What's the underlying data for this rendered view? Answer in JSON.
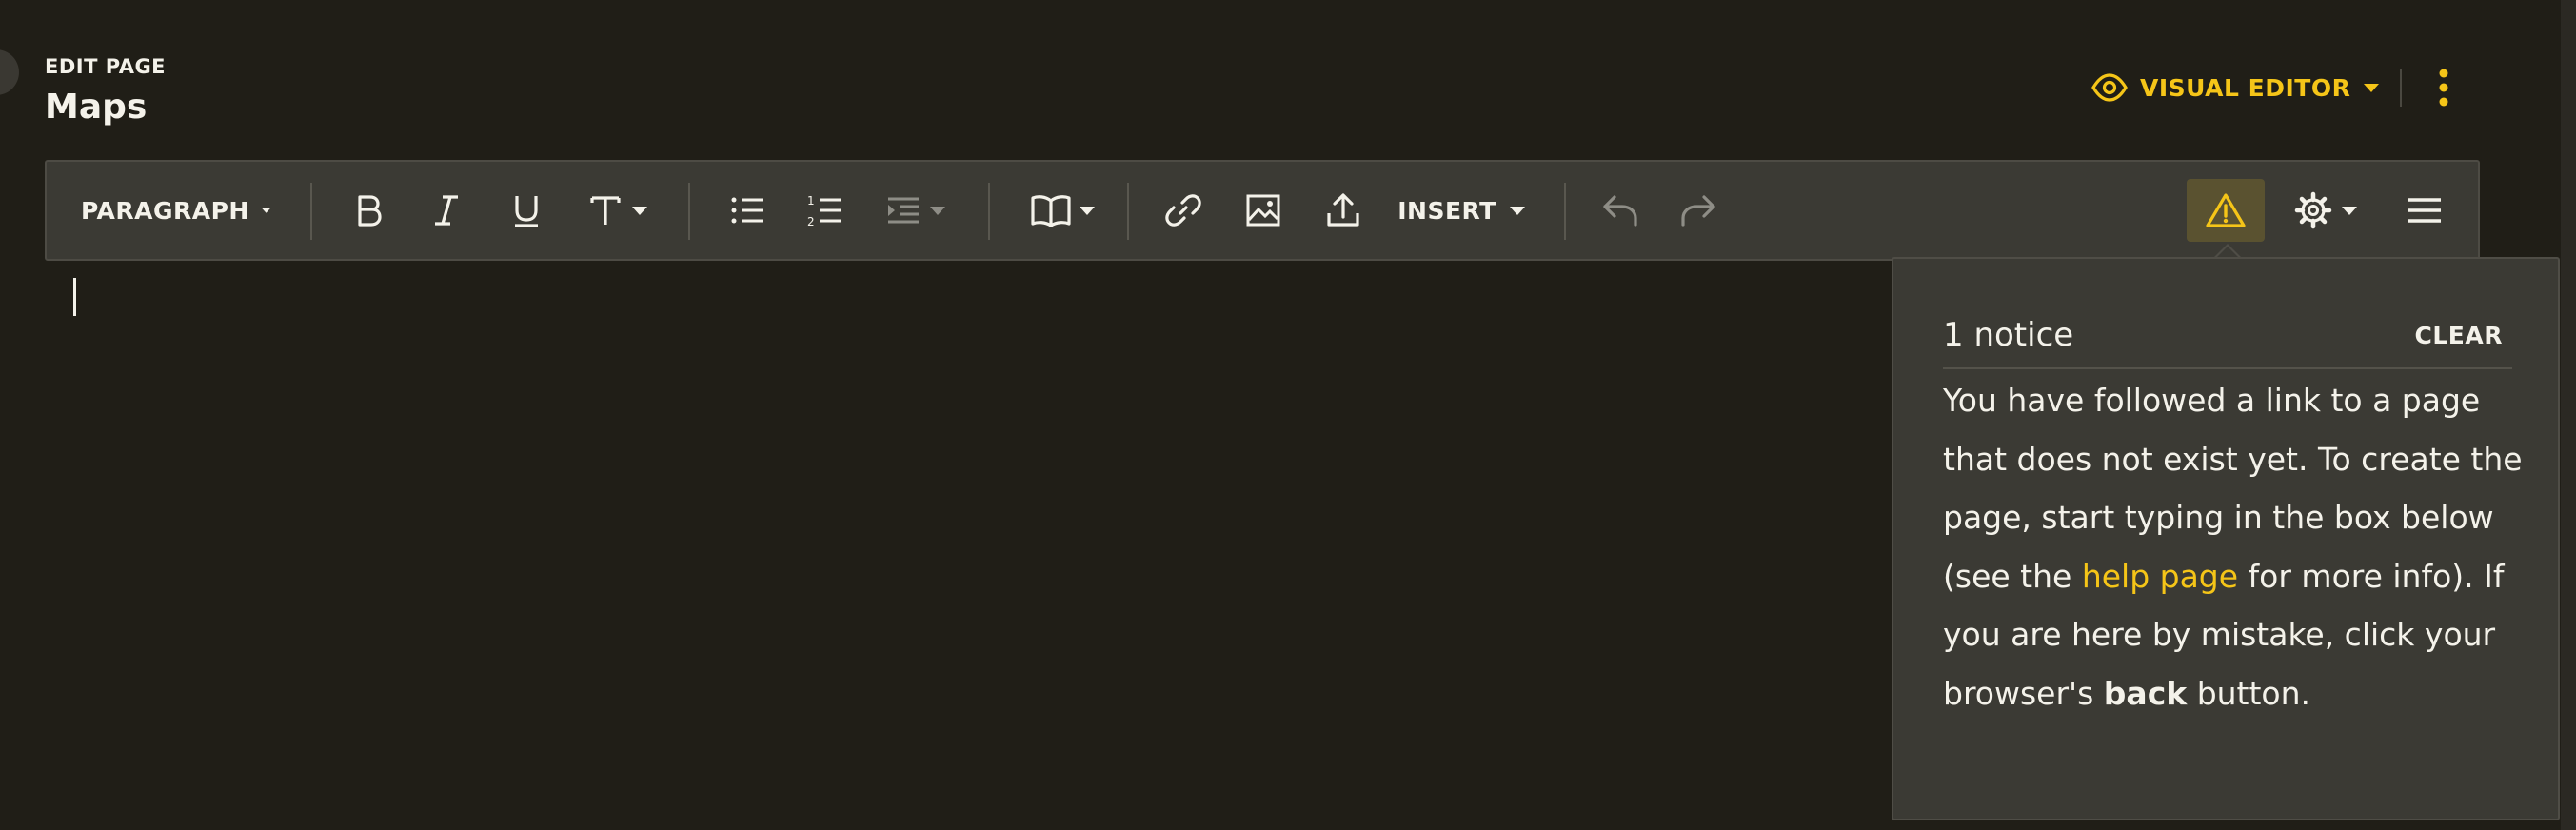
{
  "header": {
    "edit_label": "EDIT PAGE",
    "page_title": "Maps",
    "mode_label": "VISUAL EDITOR"
  },
  "toolbar": {
    "paragraph_label": "PARAGRAPH",
    "insert_label": "INSERT",
    "buttons": [
      {
        "name": "paragraph-format",
        "icon": "chevron-down-icon"
      },
      {
        "name": "bold",
        "icon": "bold-icon"
      },
      {
        "name": "italic",
        "icon": "italic-icon"
      },
      {
        "name": "underline",
        "icon": "underline-icon"
      },
      {
        "name": "text-style",
        "icon": "text-style-icon"
      },
      {
        "name": "bulleted-list",
        "icon": "bullet-list-icon"
      },
      {
        "name": "numbered-list",
        "icon": "numbered-list-icon"
      },
      {
        "name": "indent",
        "icon": "indent-icon"
      },
      {
        "name": "cite",
        "icon": "book-icon"
      },
      {
        "name": "link",
        "icon": "link-icon"
      },
      {
        "name": "image",
        "icon": "image-icon"
      },
      {
        "name": "upload",
        "icon": "upload-icon"
      },
      {
        "name": "undo",
        "icon": "undo-icon"
      },
      {
        "name": "redo",
        "icon": "redo-icon"
      },
      {
        "name": "notices",
        "icon": "warning-icon"
      },
      {
        "name": "page-options",
        "icon": "gear-icon"
      },
      {
        "name": "menu",
        "icon": "hamburger-icon"
      }
    ]
  },
  "notices": {
    "count_label": "1 notice",
    "clear_label": "CLEAR",
    "text_1": "You have followed a link to a page that does not exist yet. To create the page, start typing in the box below (see the ",
    "link_text": "help page",
    "text_2": " for more info). If you are here by mistake, click your browser's ",
    "bold_text": "back",
    "text_3": " button."
  },
  "colors": {
    "background": "#201e17",
    "toolbar": "#3b3a34",
    "accent": "#f5c518",
    "text": "#f4f2ea"
  }
}
